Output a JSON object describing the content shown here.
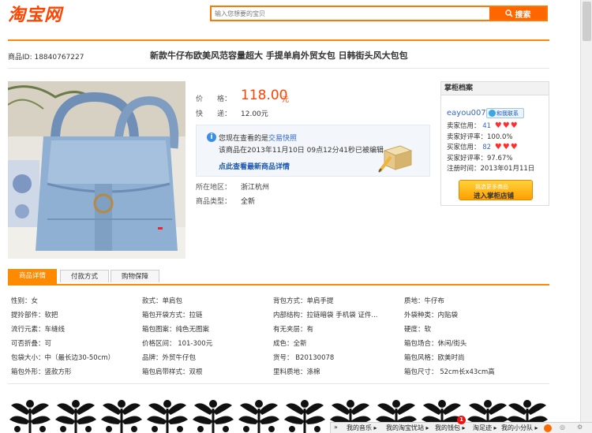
{
  "header": {
    "logo_text": "淘宝网",
    "search_placeholder": "输入您想要的宝贝",
    "search_button": "搜索"
  },
  "item": {
    "id_label": "商品ID: 18840767227",
    "title": "新款牛仔布欧美风范容量超大 手提单肩外贸女包 日韩街头风大包包"
  },
  "pricing": {
    "price_label": "价　　格：",
    "price_value": "118.00",
    "price_unit": "元",
    "express_label": "快　　递：",
    "express_value": "12.00元"
  },
  "notice": {
    "line1_prefix": "您现在查看的是",
    "line1_link": "交易快照",
    "line2": "该商品在2013年11月10日 09点12分41秒已被编辑。",
    "line3": "点此查看最新商品详情"
  },
  "location": {
    "label": "所在地区：",
    "value": "浙江杭州"
  },
  "condition": {
    "label": "商品类型：",
    "value": "全新"
  },
  "seller": {
    "heading": "掌柜档案",
    "name": "eayou007",
    "contact": "和我联系",
    "seller_credit_label": "卖家信用：",
    "seller_credit_value": "41",
    "seller_rating_label": "卖家好评率：",
    "seller_rating_value": "100.0%",
    "buyer_credit_label": "买家信用：",
    "buyer_credit_value": "82",
    "buyer_rating_label": "买家好评率：",
    "buyer_rating_value": "97.67%",
    "register_label": "注册时间：",
    "register_value": "2013年01月11日",
    "shop_button_top": "挑选更多商品",
    "shop_button_bottom": "进入掌柜店铺"
  },
  "tabs": [
    {
      "label": "商品详情"
    },
    {
      "label": "付款方式"
    },
    {
      "label": "购物保障"
    }
  ],
  "attributes": [
    [
      "性别：女",
      "款式：单肩包",
      "背包方式：单肩手提",
      "质地：牛仔布"
    ],
    [
      "提拎部件：软把",
      "箱包开袋方式：拉链",
      "内部结构：拉链暗袋 手机袋 证件...",
      "外袋种类：内贴袋"
    ],
    [
      "流行元素：车缝线",
      "箱包图案：纯色无图案",
      "有无夹层：有",
      "硬度：软"
    ],
    [
      "可否折叠：可",
      "价格区间： 101-300元",
      "成色：全新",
      "箱包场合：休闲/街头"
    ],
    [
      "包袋大小：中（最长边30-50cm）",
      "品牌：外贸牛仔包",
      "货号： B20130078",
      "箱包风格：欧美时尚"
    ],
    [
      "箱包外形：竖款方形",
      "箱包肩带样式：双根",
      "里料质地：涤棉",
      "箱包尺寸： 52cm长x43cm高"
    ]
  ],
  "toolbar": {
    "items": [
      "我的音乐",
      "我的淘宝忧站",
      "我的钱包",
      "淘足迹",
      "我的小分队"
    ],
    "badge": "1"
  }
}
